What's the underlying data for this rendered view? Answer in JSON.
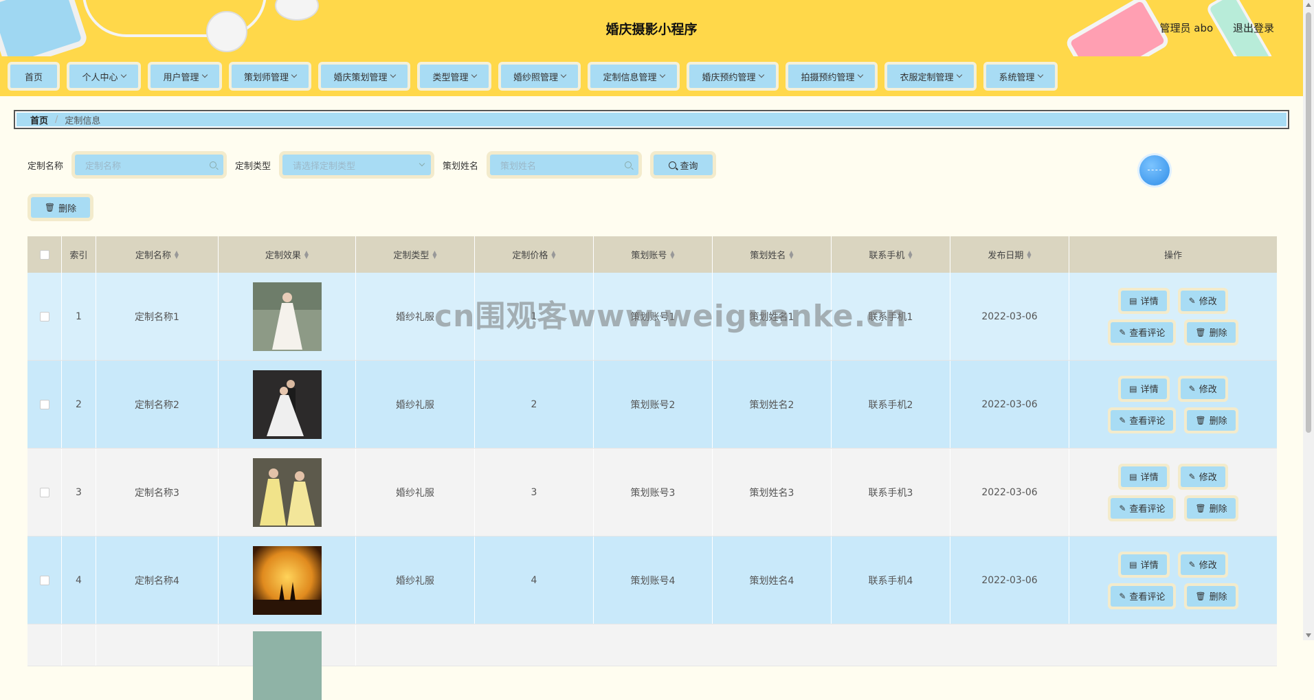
{
  "app_title": "婚庆摄影小程序",
  "user": {
    "role_name": "管理员 abo",
    "logout": "退出登录"
  },
  "nav": [
    {
      "label": "首页",
      "has_menu": false
    },
    {
      "label": "个人中心",
      "has_menu": true
    },
    {
      "label": "用户管理",
      "has_menu": true
    },
    {
      "label": "策划师管理",
      "has_menu": true
    },
    {
      "label": "婚庆策划管理",
      "has_menu": true
    },
    {
      "label": "类型管理",
      "has_menu": true
    },
    {
      "label": "婚纱照管理",
      "has_menu": true
    },
    {
      "label": "定制信息管理",
      "has_menu": true
    },
    {
      "label": "婚庆预约管理",
      "has_menu": true
    },
    {
      "label": "拍摄预约管理",
      "has_menu": true
    },
    {
      "label": "衣服定制管理",
      "has_menu": true
    },
    {
      "label": "系统管理",
      "has_menu": true
    }
  ],
  "breadcrumb": {
    "home": "首页",
    "current": "定制信息"
  },
  "search": {
    "name_label": "定制名称",
    "name_placeholder": "定制名称",
    "type_label": "定制类型",
    "type_placeholder": "请选择定制类型",
    "planner_label": "策划姓名",
    "planner_placeholder": "策划姓名",
    "query_button": "查询"
  },
  "bulk_delete": "删除",
  "table": {
    "headers": [
      "索引",
      "定制名称",
      "定制效果",
      "定制类型",
      "定制价格",
      "策划账号",
      "策划姓名",
      "联系手机",
      "发布日期",
      "操作"
    ],
    "rows": [
      {
        "index": "1",
        "name": "定制名称1",
        "type": "婚纱礼服",
        "price": "1",
        "account": "策划账号1",
        "planner": "策划姓名1",
        "phone": "联系手机1",
        "date": "2022-03-06"
      },
      {
        "index": "2",
        "name": "定制名称2",
        "type": "婚纱礼服",
        "price": "2",
        "account": "策划账号2",
        "planner": "策划姓名2",
        "phone": "联系手机2",
        "date": "2022-03-06"
      },
      {
        "index": "3",
        "name": "定制名称3",
        "type": "婚纱礼服",
        "price": "3",
        "account": "策划账号3",
        "planner": "策划姓名3",
        "phone": "联系手机3",
        "date": "2022-03-06"
      },
      {
        "index": "4",
        "name": "定制名称4",
        "type": "婚纱礼服",
        "price": "4",
        "account": "策划账号4",
        "planner": "策划姓名4",
        "phone": "联系手机4",
        "date": "2022-03-06"
      }
    ],
    "actions": {
      "detail": "详情",
      "edit": "修改",
      "comments": "查看评论",
      "delete": "删除"
    }
  },
  "watermark": "cn围观客www.weiguanke.cn"
}
